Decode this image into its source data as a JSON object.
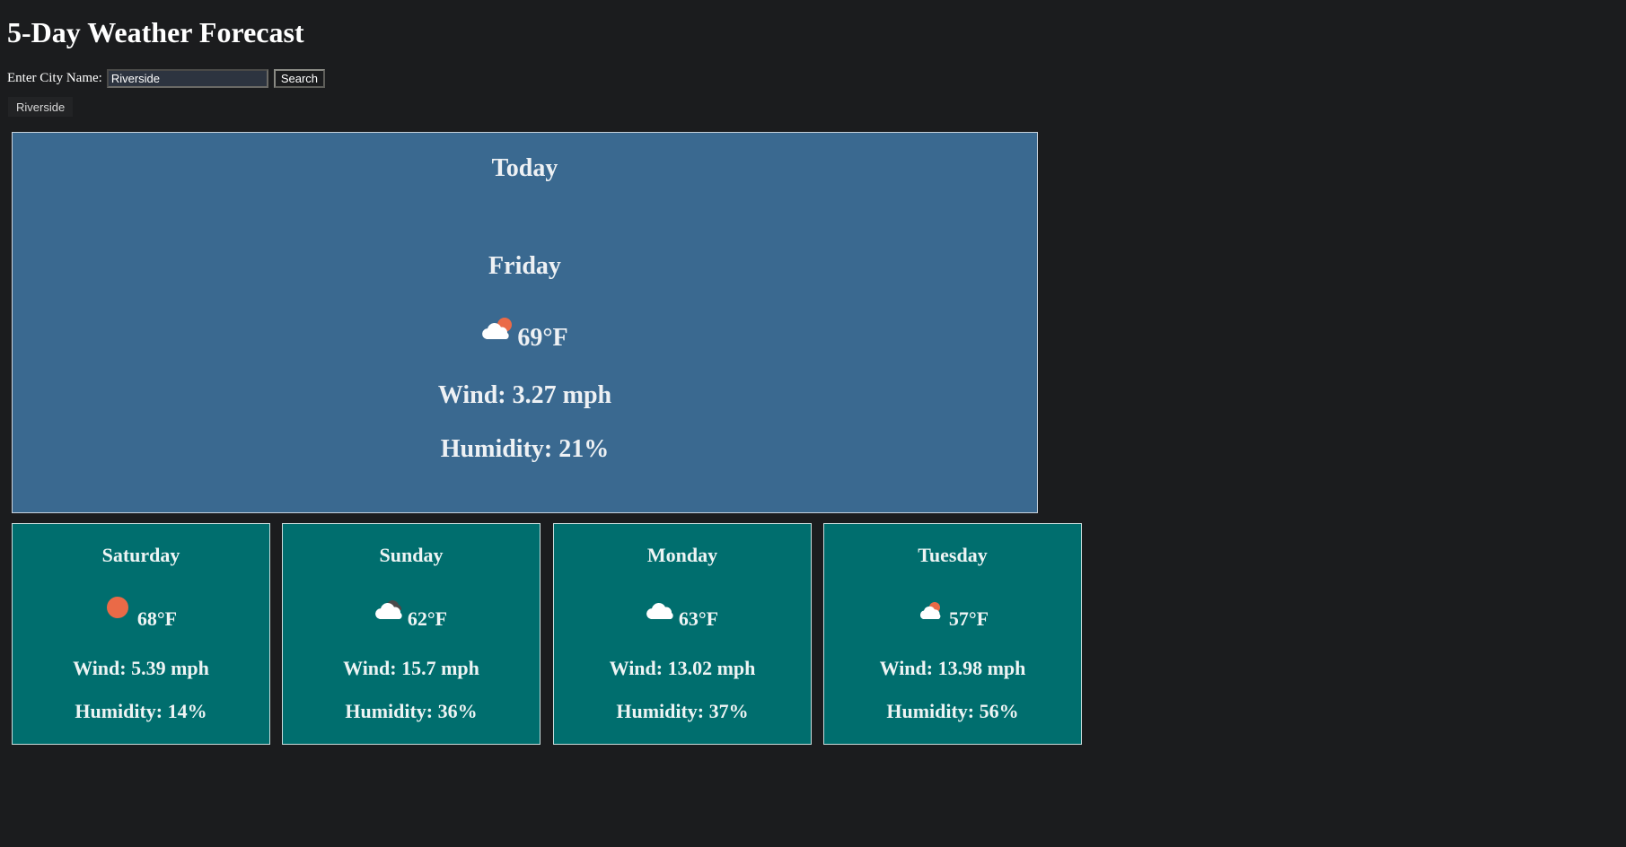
{
  "header": {
    "title": "5-Day Weather Forecast"
  },
  "search": {
    "label": "Enter City Name:",
    "value": "Riverside",
    "button_label": "Search"
  },
  "history": {
    "items": [
      "Riverside"
    ]
  },
  "today": {
    "heading": "Today",
    "day": "Friday",
    "icon": "few-clouds-day-icon",
    "temp": "69°F",
    "wind": "Wind: 3.27 mph",
    "humidity": "Humidity: 21%"
  },
  "forecast": [
    {
      "day": "Saturday",
      "icon": "clear-sky-sun-icon",
      "temp": "68°F",
      "wind": "Wind: 5.39 mph",
      "humidity": "Humidity: 14%"
    },
    {
      "day": "Sunday",
      "icon": "cloud-dark-icon",
      "temp": "62°F",
      "wind": "Wind: 15.7 mph",
      "humidity": "Humidity: 36%"
    },
    {
      "day": "Monday",
      "icon": "cloud-icon",
      "temp": "63°F",
      "wind": "Wind: 13.02 mph",
      "humidity": "Humidity: 37%"
    },
    {
      "day": "Tuesday",
      "icon": "few-clouds-day-icon",
      "temp": "57°F",
      "wind": "Wind: 13.98 mph",
      "humidity": "Humidity: 56%"
    }
  ],
  "colors": {
    "background": "#1b1c1e",
    "today_panel": "#3a6990",
    "forecast_card": "#006e6e",
    "sun": "#ea6a47",
    "cloud": "#ffffff"
  }
}
